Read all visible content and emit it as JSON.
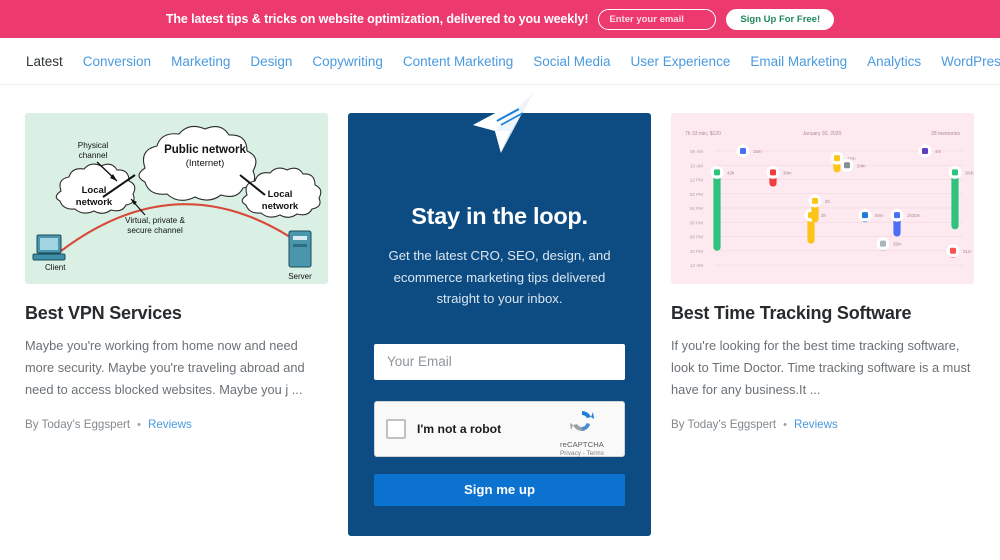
{
  "banner": {
    "text": "The latest tips & tricks on website optimization, delivered to you weekly!",
    "email_placeholder": "Enter your email",
    "email_value": "",
    "cta_label": "Sign Up For Free!",
    "bg_color": "#ec3a6e",
    "cta_text_color": "#1f8a5a"
  },
  "nav": {
    "items": [
      {
        "label": "Latest",
        "active": true
      },
      {
        "label": "Conversion",
        "active": false
      },
      {
        "label": "Marketing",
        "active": false
      },
      {
        "label": "Design",
        "active": false
      },
      {
        "label": "Copywriting",
        "active": false
      },
      {
        "label": "Content Marketing",
        "active": false
      },
      {
        "label": "Social Media",
        "active": false
      },
      {
        "label": "User Experience",
        "active": false
      },
      {
        "label": "Email Marketing",
        "active": false
      },
      {
        "label": "Analytics",
        "active": false
      },
      {
        "label": "WordPress",
        "active": false
      }
    ],
    "link_color": "#4a9ae0",
    "active_color": "#2f3437"
  },
  "articles": [
    {
      "title": "Best VPN Services",
      "excerpt": "Maybe you're working from home now and need more security. Maybe you're traveling abroad and need to access blocked websites. Maybe you j ...",
      "author": "By Today's Eggspert",
      "separator": "•",
      "category": "Reviews",
      "thumb_kind": "vpn-diagram",
      "thumb_bg": "#daf0e4"
    },
    {
      "title": "Best Time Tracking Software",
      "excerpt": "If you're looking for the best time tracking software, look to Time Doctor. Time tracking software is a must have for any business.It ...",
      "author": "By Today's Eggspert",
      "separator": "•",
      "category": "Reviews",
      "thumb_kind": "time-tracking-chart",
      "thumb_bg": "#fdeaf0"
    }
  ],
  "vpn_diagram": {
    "labels": {
      "physical_channel_line1": "Physical",
      "physical_channel_line2": "channel",
      "public_network_line1": "Public network",
      "public_network_line2": "(Internet)",
      "local_network_left_line1": "Local",
      "local_network_left_line2": "network",
      "local_network_right_line1": "Local",
      "local_network_right_line2": "network",
      "secure_channel_line1": "Virtual, private &",
      "secure_channel_line2": "secure channel",
      "client": "Client",
      "server": "Server"
    },
    "tunnel_color": "#d84a3a",
    "device_color": "#3f8fa8"
  },
  "newsletter": {
    "icon": "paper-plane-icon",
    "title": "Stay in the loop.",
    "subtitle": "Get the latest CRO, SEO, design, and ecommerce marketing tips delivered straight to your inbox.",
    "email_placeholder": "Your Email",
    "email_value": "",
    "captcha": {
      "label": "I'm not a robot",
      "checked": false,
      "brand": "reCAPTCHA",
      "links": "Privacy - Terms"
    },
    "submit_label": "Sign me up",
    "panel_color": "#0d4c82",
    "submit_color": "#0c72cf"
  },
  "chart_data": {
    "type": "bar",
    "title": "January 30, 2020",
    "header_left": "7h 33 min, $120",
    "header_right": "28 memories",
    "xlabel": "",
    "ylabel": "",
    "grid": true,
    "legend": "none",
    "yticks": [
      "08 AM",
      "10 AM",
      "12 PM",
      "02 PM",
      "04 PM",
      "06 PM",
      "08 PM",
      "10 PM",
      "12 AM"
    ],
    "ylim": [
      "08 AM",
      "12 AM"
    ],
    "bg_color": "#fdeaf0",
    "series": [
      {
        "name": "task-1",
        "label": "42h",
        "color": "#2ec27e",
        "start": "11 AM",
        "end": "10 PM"
      },
      {
        "name": "task-2",
        "label": "15m",
        "color": "#4c6ef5",
        "start": "08 AM",
        "end": "08 AM"
      },
      {
        "name": "task-3",
        "label": "30m",
        "color": "#f03e3e",
        "start": "11 AM",
        "end": "01 PM"
      },
      {
        "name": "task-4",
        "label": "3h",
        "color": "#fcc419",
        "start": "05 PM",
        "end": "09 PM"
      },
      {
        "name": "task-5",
        "label": "47m",
        "color": "#fcc419",
        "start": "09 AM",
        "end": "11 AM"
      },
      {
        "name": "task-6",
        "label": "50m",
        "color": "#1c7ed6",
        "start": "05 PM",
        "end": "06 PM"
      },
      {
        "name": "task-7",
        "label": "35m",
        "color": "#adb5bd",
        "start": "09 PM",
        "end": "10 PM"
      },
      {
        "name": "task-8",
        "label": "2h",
        "color": "#fcc419",
        "start": "03 PM",
        "end": "06 PM"
      },
      {
        "name": "task-9",
        "label": "24m",
        "color": "#868e96",
        "start": "10 AM",
        "end": "10 AM"
      },
      {
        "name": "task-10",
        "label": "1h30m",
        "color": "#4c6ef5",
        "start": "05 PM",
        "end": "08 PM"
      },
      {
        "name": "task-11",
        "label": "4m",
        "color": "#5f3dc4",
        "start": "08 AM",
        "end": "08 AM"
      },
      {
        "name": "task-12",
        "label": "3h30m",
        "color": "#2ec27e",
        "start": "11 AM",
        "end": "07 PM"
      },
      {
        "name": "task-13",
        "label": "21m",
        "color": "#fa5252",
        "start": "10 PM",
        "end": "11 PM"
      }
    ]
  }
}
